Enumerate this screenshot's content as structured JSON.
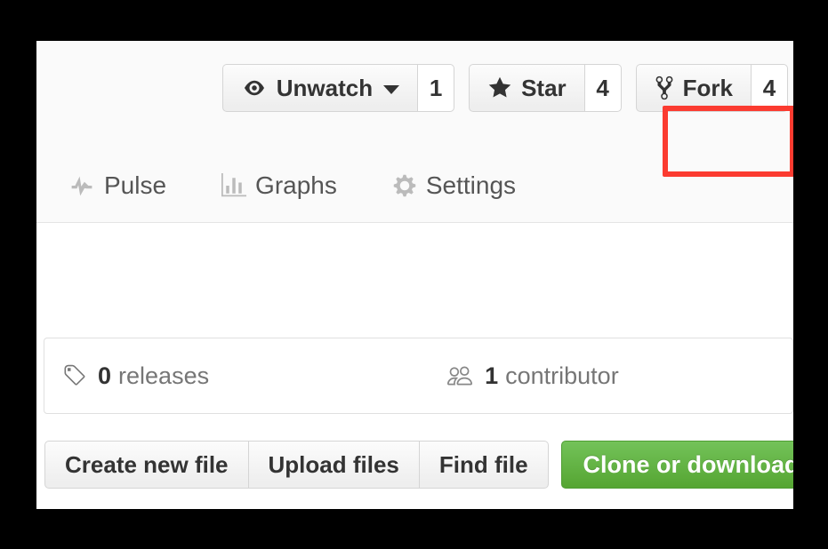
{
  "colors": {
    "highlight": "#fb3b30",
    "clone_button": "#60b044",
    "header_bg": "#fafafa",
    "muted_text": "#767676"
  },
  "pagehead_actions": [
    {
      "name": "watch",
      "label": "Unwatch",
      "icon": "eye-icon",
      "has_caret": true,
      "count": "1"
    },
    {
      "name": "star",
      "label": "Star",
      "icon": "star-icon",
      "has_caret": false,
      "count": "4"
    },
    {
      "name": "fork",
      "label": "Fork",
      "icon": "repo-forked-icon",
      "has_caret": false,
      "count": "4",
      "highlighted": true
    }
  ],
  "repo_nav": [
    {
      "name": "pulse",
      "label": "Pulse",
      "icon": "pulse-icon"
    },
    {
      "name": "graphs",
      "label": "Graphs",
      "icon": "graph-icon"
    },
    {
      "name": "settings",
      "label": "Settings",
      "icon": "gear-icon"
    }
  ],
  "numbers_summary": [
    {
      "name": "releases",
      "count": "0",
      "label": "releases",
      "icon": "tag-icon"
    },
    {
      "name": "contributors",
      "count": "1",
      "label": "contributor",
      "icon": "people-icon"
    }
  ],
  "file_navigation": {
    "buttons": [
      {
        "name": "create-new-file",
        "label": "Create new file"
      },
      {
        "name": "upload-files",
        "label": "Upload files"
      },
      {
        "name": "find-file",
        "label": "Find file"
      }
    ],
    "clone": {
      "label": "Clone or download",
      "has_caret": true
    }
  }
}
